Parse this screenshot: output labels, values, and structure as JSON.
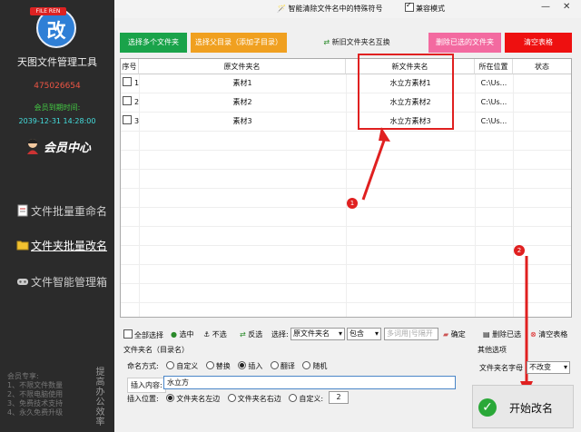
{
  "sidebar": {
    "logo_flag": "FILE REN",
    "logo_char": "改",
    "app_title": "天图文件管理工具",
    "user_id": "475026654",
    "vip_label": "会员到期时间:",
    "vip_date": "2039-12-31 14:28:00",
    "member_center": "会员中心",
    "nav": [
      {
        "label": "文件批量重命名"
      },
      {
        "label": "文件夹批量改名"
      },
      {
        "label": "文件智能管理箱"
      }
    ],
    "benefits": [
      "会员专享:",
      "1、不限文件数量",
      "2、不限电脑使用",
      "3、免费技术支持",
      "4、永久免费升级"
    ],
    "slogan": "提高办公效率"
  },
  "topbar": {
    "special_chars": "智能清除文件名中的特殊符号",
    "compat": "兼容模式",
    "compat_checked": true
  },
  "toolbar": {
    "select_multi": "选择多个文件夹",
    "select_parent": "选择父目录（添加子目录）",
    "swap": "新旧文件夹名互换",
    "delete_selected": "删除已选的文件夹",
    "clear_table": "清空表格"
  },
  "table": {
    "headers": [
      "序号",
      "原文件夹名",
      "新文件夹名",
      "所在位置",
      "状态"
    ],
    "rows": [
      {
        "no": "1",
        "orig": "素材1",
        "new": "水立方素材1",
        "loc": "C:\\Us...",
        "status": ""
      },
      {
        "no": "2",
        "orig": "素材2",
        "new": "水立方素材2",
        "loc": "C:\\Us...",
        "status": ""
      },
      {
        "no": "3",
        "orig": "素材3",
        "new": "水立方素材3",
        "loc": "C:\\Us...",
        "status": ""
      }
    ]
  },
  "annotations": {
    "marker1": "1",
    "marker2": "2",
    "accent": "#e02020"
  },
  "tools": {
    "select_all": "全部选择",
    "select": "选中",
    "deselect": "不选",
    "invert": "反选",
    "choose": "选择:",
    "scope": "原文件夹名",
    "match": "包含",
    "multi_placeholder": "多词用|号隔开",
    "confirm": "确定",
    "delete_selected": "删除已选",
    "clear_table": "清空表格"
  },
  "settings": {
    "title": "文件夹名（目录名）",
    "naming_label": "命名方式:",
    "modes": [
      "自定义",
      "替换",
      "插入",
      "翻译",
      "随机"
    ],
    "active_mode": "插入",
    "insert_label": "插入内容:",
    "insert_value": "水立方",
    "position_label": "插入位置:",
    "positions": [
      "文件夹名左边",
      "文件夹名右边",
      "自定义:"
    ],
    "position_value": "2"
  },
  "other": {
    "title": "其他选项",
    "case_label": "文件夹名字母",
    "case_value": "不改变"
  },
  "start": {
    "label": "开始改名"
  }
}
